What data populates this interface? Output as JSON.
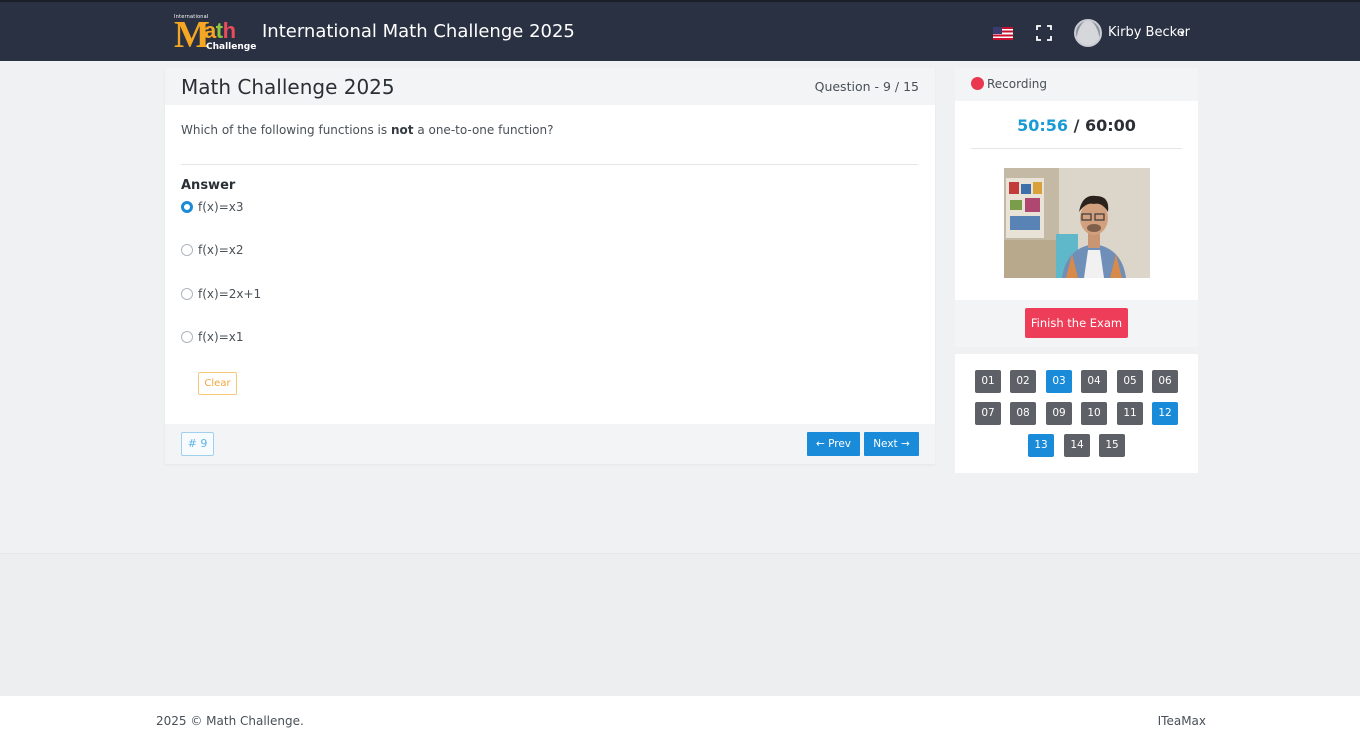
{
  "header": {
    "logo": {
      "top_text": "International",
      "main_m": "M",
      "main_ath": [
        "a",
        "t",
        "h"
      ],
      "sub": "Challenge"
    },
    "title": "International Math Challenge 2025",
    "user_name": "Kirby Becker",
    "language_icon": "us-flag-icon",
    "fullscreen_icon": "fullscreen-icon"
  },
  "question_card": {
    "title": "Math Challenge 2025",
    "counter": "Question - 9 / 15",
    "text_before": "Which of the following functions is ",
    "text_bold": "not",
    "text_after": " a one-to-one function?",
    "answer_label": "Answer",
    "options": [
      {
        "label": "f(x)=x3",
        "selected": true
      },
      {
        "label": "f(x)=x2",
        "selected": false
      },
      {
        "label": "f(x)=2x+1",
        "selected": false
      },
      {
        "label": "f(x)=x1",
        "selected": false
      }
    ],
    "clear_label": "Clear",
    "question_tag": "# 9",
    "prev_label": "←   Prev",
    "next_label": "Next   →"
  },
  "proctor": {
    "recording_label": "Recording",
    "elapsed": "50:56",
    "separator": " / ",
    "total": "60:00",
    "finish_label": "Finish the Exam"
  },
  "navigator": {
    "questions": [
      {
        "label": "01",
        "answered": false
      },
      {
        "label": "02",
        "answered": false
      },
      {
        "label": "03",
        "answered": true
      },
      {
        "label": "04",
        "answered": false
      },
      {
        "label": "05",
        "answered": false
      },
      {
        "label": "06",
        "answered": false
      },
      {
        "label": "07",
        "answered": false
      },
      {
        "label": "08",
        "answered": false
      },
      {
        "label": "09",
        "answered": false
      },
      {
        "label": "10",
        "answered": false
      },
      {
        "label": "11",
        "answered": false
      },
      {
        "label": "12",
        "answered": true
      },
      {
        "label": "13",
        "answered": true
      },
      {
        "label": "14",
        "answered": false
      },
      {
        "label": "15",
        "answered": false
      }
    ]
  },
  "footer": {
    "copyright": "2025 © Math Challenge.",
    "brand": "ITeaMax"
  },
  "colors": {
    "primary": "#1a8bd9",
    "danger": "#ee3d58",
    "topbar": "#2a3142",
    "unanswered": "#5d6167"
  }
}
